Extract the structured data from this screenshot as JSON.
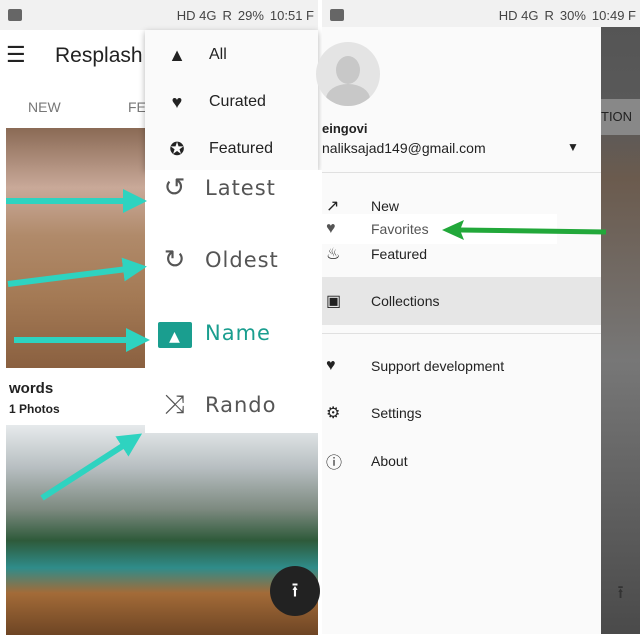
{
  "left": {
    "status": {
      "network": "HD 4G",
      "roaming": "R",
      "battery": "29%",
      "time": "10:51 F"
    },
    "toolbar": {
      "title": "Resplash",
      "menu_icon": "hamburger-icon"
    },
    "tabs": [
      "NEW",
      "FEA"
    ],
    "collection": {
      "name": "words",
      "count": "1 Photos"
    },
    "filter_menu": [
      {
        "icon": "mountains-icon",
        "label": "All"
      },
      {
        "icon": "heart-icon",
        "label": "Curated"
      },
      {
        "icon": "star-circle-icon",
        "label": "Featured"
      }
    ],
    "sort_menu": [
      {
        "icon": "history-icon",
        "label": "Latest"
      },
      {
        "icon": "clock-forward-icon",
        "label": "Oldest"
      },
      {
        "icon": "image-icon",
        "label": "Name",
        "selected": true
      },
      {
        "icon": "shuffle-icon",
        "label": "Rando"
      }
    ],
    "accent": "#1a9e8f",
    "arrow_color": "#2ed3c0"
  },
  "right": {
    "status": {
      "network": "HD 4G",
      "roaming": "R",
      "battery": "30%",
      "time": "10:49 F"
    },
    "account": {
      "name": "eingovi",
      "email": "naliksajad149@gmail.com"
    },
    "tab_fragment": "TION",
    "nav": [
      {
        "icon": "trending-icon",
        "label": "New"
      },
      {
        "icon": "heart-icon",
        "label": "Favorites"
      },
      {
        "icon": "fire-icon",
        "label": "Featured"
      },
      {
        "icon": "collections-icon",
        "label": "Collections",
        "selected": true
      }
    ],
    "nav2": [
      {
        "icon": "heart-icon",
        "label": "Support development"
      },
      {
        "icon": "gear-icon",
        "label": "Settings"
      },
      {
        "icon": "info-icon",
        "label": "About"
      }
    ],
    "arrow_color": "#22a83a"
  }
}
